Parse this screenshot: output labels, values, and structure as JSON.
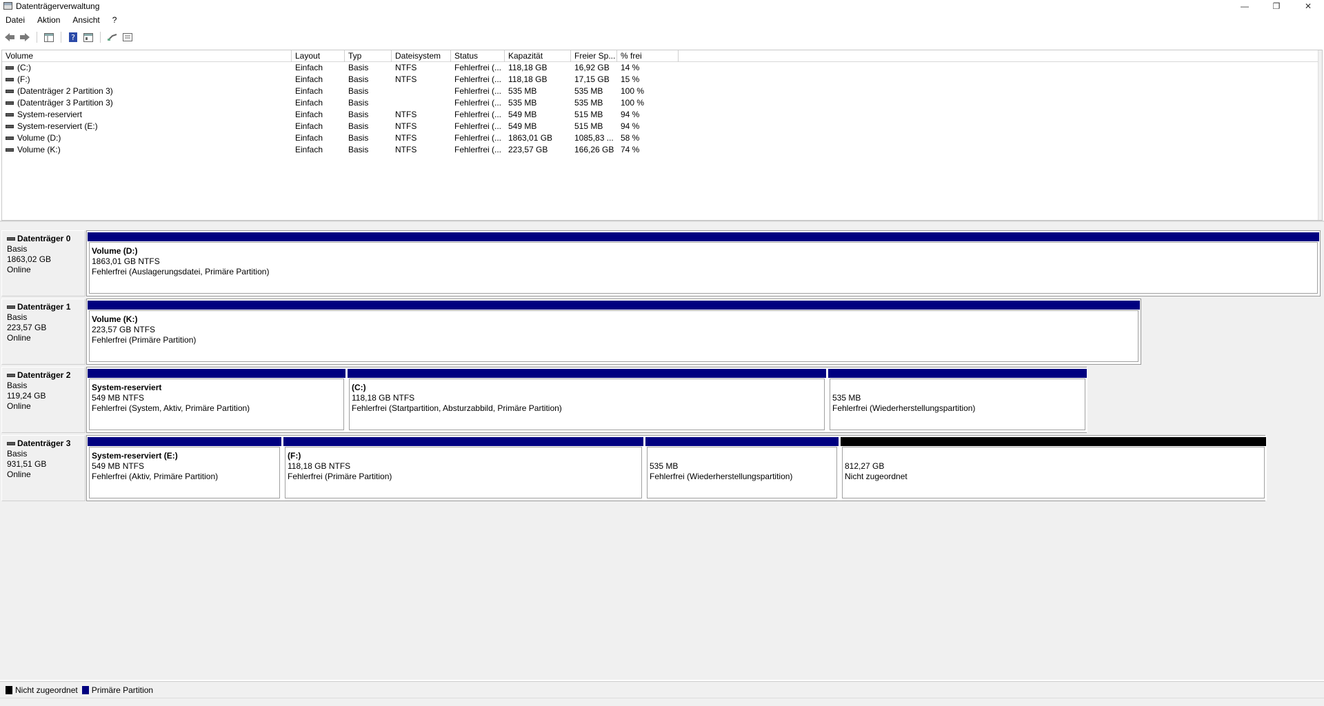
{
  "window": {
    "title": "Datenträgerverwaltung",
    "controls": {
      "minimize": "—",
      "restore": "❐",
      "close": "✕"
    }
  },
  "menu": [
    "Datei",
    "Aktion",
    "Ansicht",
    "?"
  ],
  "toolbar": {
    "icons": [
      "back-arrow-icon",
      "forward-arrow-icon",
      "console-tree-icon",
      "help-icon",
      "properties-icon",
      "connect-icon",
      "details-icon"
    ]
  },
  "table": {
    "columns": [
      "Volume",
      "Layout",
      "Typ",
      "Dateisystem",
      "Status",
      "Kapazität",
      "Freier Sp...",
      "% frei"
    ],
    "rows": [
      [
        "(C:)",
        "Einfach",
        "Basis",
        "NTFS",
        "Fehlerfrei (...",
        "118,18 GB",
        "16,92 GB",
        "14 %"
      ],
      [
        "(F:)",
        "Einfach",
        "Basis",
        "NTFS",
        "Fehlerfrei (...",
        "118,18 GB",
        "17,15 GB",
        "15 %"
      ],
      [
        "(Datenträger 2 Partition 3)",
        "Einfach",
        "Basis",
        "",
        "Fehlerfrei (...",
        "535 MB",
        "535 MB",
        "100 %"
      ],
      [
        "(Datenträger 3 Partition 3)",
        "Einfach",
        "Basis",
        "",
        "Fehlerfrei (...",
        "535 MB",
        "535 MB",
        "100 %"
      ],
      [
        "System-reserviert",
        "Einfach",
        "Basis",
        "NTFS",
        "Fehlerfrei (...",
        "549 MB",
        "515 MB",
        "94 %"
      ],
      [
        "System-reserviert (E:)",
        "Einfach",
        "Basis",
        "NTFS",
        "Fehlerfrei (...",
        "549 MB",
        "515 MB",
        "94 %"
      ],
      [
        "Volume (D:)",
        "Einfach",
        "Basis",
        "NTFS",
        "Fehlerfrei (...",
        "1863,01 GB",
        "1085,83 ...",
        "58 %"
      ],
      [
        "Volume (K:)",
        "Einfach",
        "Basis",
        "NTFS",
        "Fehlerfrei (...",
        "223,57 GB",
        "166,26 GB",
        "74 %"
      ]
    ]
  },
  "disks": [
    {
      "name": "Datenträger 0",
      "type": "Basis",
      "size": "1863,02 GB",
      "state": "Online",
      "partitions": [
        {
          "name": "Volume  (D:)",
          "size": "1863,01 GB NTFS",
          "status": "Fehlerfrei (Auslagerungsdatei, Primäre Partition)",
          "kind": "primary"
        }
      ]
    },
    {
      "name": "Datenträger 1",
      "type": "Basis",
      "size": "223,57 GB",
      "state": "Online",
      "partitions": [
        {
          "name": "Volume  (K:)",
          "size": "223,57 GB NTFS",
          "status": "Fehlerfrei (Primäre Partition)",
          "kind": "primary"
        }
      ]
    },
    {
      "name": "Datenträger 2",
      "type": "Basis",
      "size": "119,24 GB",
      "state": "Online",
      "partitions": [
        {
          "name": "System-reserviert",
          "size": "549 MB NTFS",
          "status": "Fehlerfrei (System, Aktiv, Primäre Partition)",
          "kind": "primary"
        },
        {
          "name": "(C:)",
          "size": "118,18 GB NTFS",
          "status": "Fehlerfrei (Startpartition, Absturzabbild, Primäre Partition)",
          "kind": "primary"
        },
        {
          "name": "",
          "size": "535 MB",
          "status": "Fehlerfrei (Wiederherstellungspartition)",
          "kind": "primary"
        }
      ]
    },
    {
      "name": "Datenträger 3",
      "type": "Basis",
      "size": "931,51 GB",
      "state": "Online",
      "partitions": [
        {
          "name": "System-reserviert  (E:)",
          "size": "549 MB NTFS",
          "status": "Fehlerfrei (Aktiv, Primäre Partition)",
          "kind": "primary"
        },
        {
          "name": "(F:)",
          "size": "118,18 GB NTFS",
          "status": "Fehlerfrei (Primäre Partition)",
          "kind": "primary"
        },
        {
          "name": "",
          "size": "535 MB",
          "status": "Fehlerfrei (Wiederherstellungspartition)",
          "kind": "primary"
        },
        {
          "name": "",
          "size": "812,27 GB",
          "status": "Nicht zugeordnet",
          "kind": "unallocated"
        }
      ]
    }
  ],
  "legend": {
    "unallocated": "Nicht zugeordnet",
    "primary": "Primäre Partition",
    "colors": {
      "unallocated": "#000000",
      "primary": "#000080"
    }
  }
}
